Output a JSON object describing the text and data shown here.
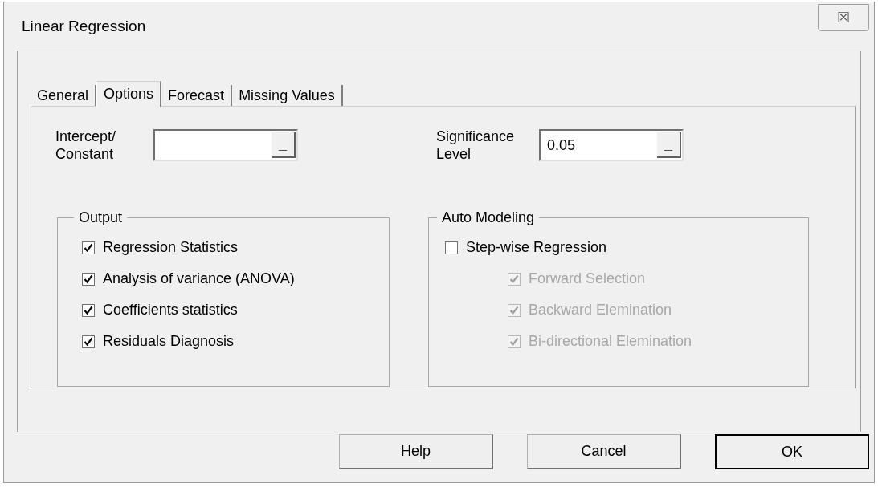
{
  "window": {
    "title": "Linear Regression",
    "close": "☒"
  },
  "tabs": [
    {
      "label": "General",
      "selected": false
    },
    {
      "label": "Options",
      "selected": true
    },
    {
      "label": "Forecast",
      "selected": false
    },
    {
      "label": "Missing Values",
      "selected": false
    }
  ],
  "fields": [
    {
      "label": "Intercept/\nConstant",
      "button": "_"
    },
    {
      "label": "Significance\nLevel",
      "value": "0.05",
      "button": "_"
    }
  ],
  "output": {
    "legend": "Output",
    "items": [
      {
        "label": "Regression Statistics",
        "checked": true,
        "disabled": false
      },
      {
        "label": "Analysis of variance (ANOVA)",
        "checked": true,
        "disabled": false
      },
      {
        "label": "Coefficients statistics",
        "checked": true,
        "disabled": false
      },
      {
        "label": "Residuals Diagnosis",
        "checked": true,
        "disabled": false
      }
    ]
  },
  "auto_modeling": {
    "legend": "Auto Modeling",
    "items": [
      {
        "label": "Step-wise Regression",
        "checked": false,
        "disabled": false,
        "children": [
          {
            "label": "Forward Selection",
            "checked": true,
            "disabled": true
          },
          {
            "label": "Backward Elemination",
            "checked": true,
            "disabled": true
          },
          {
            "label": "Bi-directional Elemination",
            "checked": true,
            "disabled": true
          }
        ]
      }
    ]
  },
  "buttons": [
    {
      "label": "Help",
      "default": false
    },
    {
      "label": "Cancel",
      "default": false
    },
    {
      "label": "OK",
      "default": true
    }
  ]
}
